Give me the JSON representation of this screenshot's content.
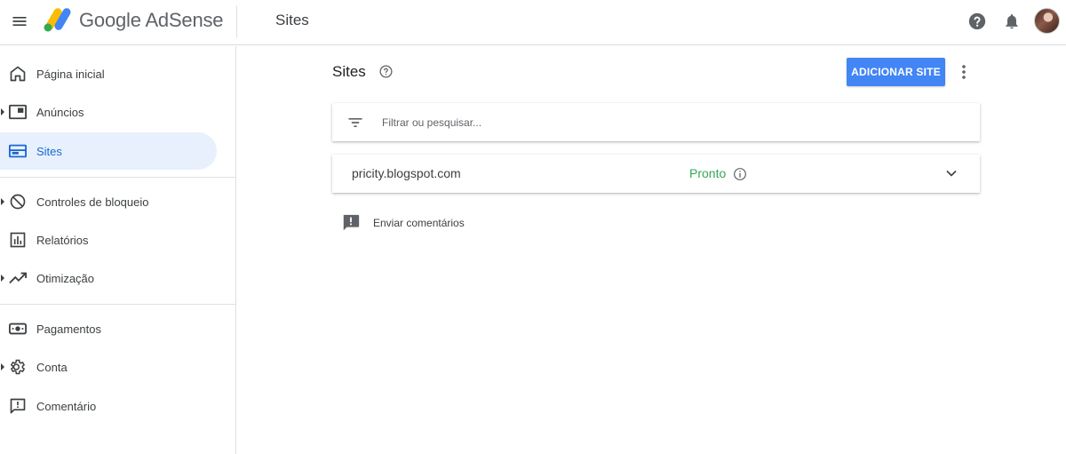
{
  "header": {
    "product_name": "Google AdSense",
    "page_title": "Sites",
    "icons": {
      "menu": "menu-icon",
      "help": "help-icon",
      "notifications": "bell-icon",
      "avatar": "avatar"
    }
  },
  "sidebar": {
    "items": [
      {
        "label": "Página inicial",
        "icon": "home-icon",
        "expandable": false,
        "active": false
      },
      {
        "label": "Anúncios",
        "icon": "ads-icon",
        "expandable": true,
        "active": false
      },
      {
        "label": "Sites",
        "icon": "sites-icon",
        "expandable": false,
        "active": true
      },
      {
        "label": "Controles de bloqueio",
        "icon": "block-icon",
        "expandable": true,
        "active": false
      },
      {
        "label": "Relatórios",
        "icon": "reports-icon",
        "expandable": false,
        "active": false
      },
      {
        "label": "Otimização",
        "icon": "trending-icon",
        "expandable": true,
        "active": false
      },
      {
        "label": "Pagamentos",
        "icon": "payments-icon",
        "expandable": false,
        "active": false
      },
      {
        "label": "Conta",
        "icon": "gear-icon",
        "expandable": true,
        "active": false
      },
      {
        "label": "Comentário",
        "icon": "feedback-icon",
        "expandable": false,
        "active": false
      }
    ]
  },
  "main": {
    "title": "Sites",
    "add_button": "ADICIONAR SITE",
    "filter": {
      "placeholder": "Filtrar ou pesquisar...",
      "value": ""
    },
    "sites": [
      {
        "domain": "pricity.blogspot.com",
        "status": "Pronto"
      }
    ],
    "feedback_label": "Enviar comentários"
  },
  "colors": {
    "accent": "#4285f4",
    "active_bg": "#e8f0fe",
    "active_text": "#1967d2",
    "status_ready": "#34a853"
  }
}
